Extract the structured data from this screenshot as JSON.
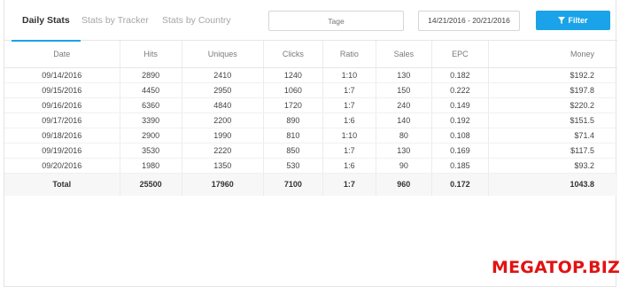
{
  "tabs": [
    {
      "label": "Daily Stats",
      "active": true
    },
    {
      "label": "Stats by Tracker",
      "active": false
    },
    {
      "label": "Stats by Country",
      "active": false
    }
  ],
  "tag_input": {
    "placeholder": "Tage"
  },
  "date_range": {
    "value": "14/21/2016 - 20/21/2016"
  },
  "filter_button": {
    "label": "Filter",
    "icon": "funnel-icon"
  },
  "table": {
    "columns": [
      "Date",
      "Hits",
      "Uniques",
      "Clicks",
      "Ratio",
      "Sales",
      "EPC",
      "Money"
    ],
    "rows": [
      [
        "09/14/2016",
        "2890",
        "2410",
        "1240",
        "1:10",
        "130",
        "0.182",
        "$192.2"
      ],
      [
        "09/15/2016",
        "4450",
        "2950",
        "1060",
        "1:7",
        "150",
        "0.222",
        "$197.8"
      ],
      [
        "09/16/2016",
        "6360",
        "4840",
        "1720",
        "1:7",
        "240",
        "0.149",
        "$220.2"
      ],
      [
        "09/17/2016",
        "3390",
        "2200",
        "890",
        "1:6",
        "140",
        "0.192",
        "$151.5"
      ],
      [
        "09/18/2016",
        "2900",
        "1990",
        "810",
        "1:10",
        "80",
        "0.108",
        "$71.4"
      ],
      [
        "09/19/2016",
        "3530",
        "2220",
        "850",
        "1:7",
        "130",
        "0.169",
        "$117.5"
      ],
      [
        "09/20/2016",
        "1980",
        "1350",
        "530",
        "1:6",
        "90",
        "0.185",
        "$93.2"
      ]
    ],
    "total": [
      "Total",
      "25500",
      "17960",
      "7100",
      "1:7",
      "960",
      "0.172",
      "1043.8"
    ]
  },
  "watermark": "MEGATOP.BIZ",
  "colors": {
    "accent": "#1aa3e8",
    "watermark": "#e31212",
    "total_bg": "#f7f7f7"
  }
}
